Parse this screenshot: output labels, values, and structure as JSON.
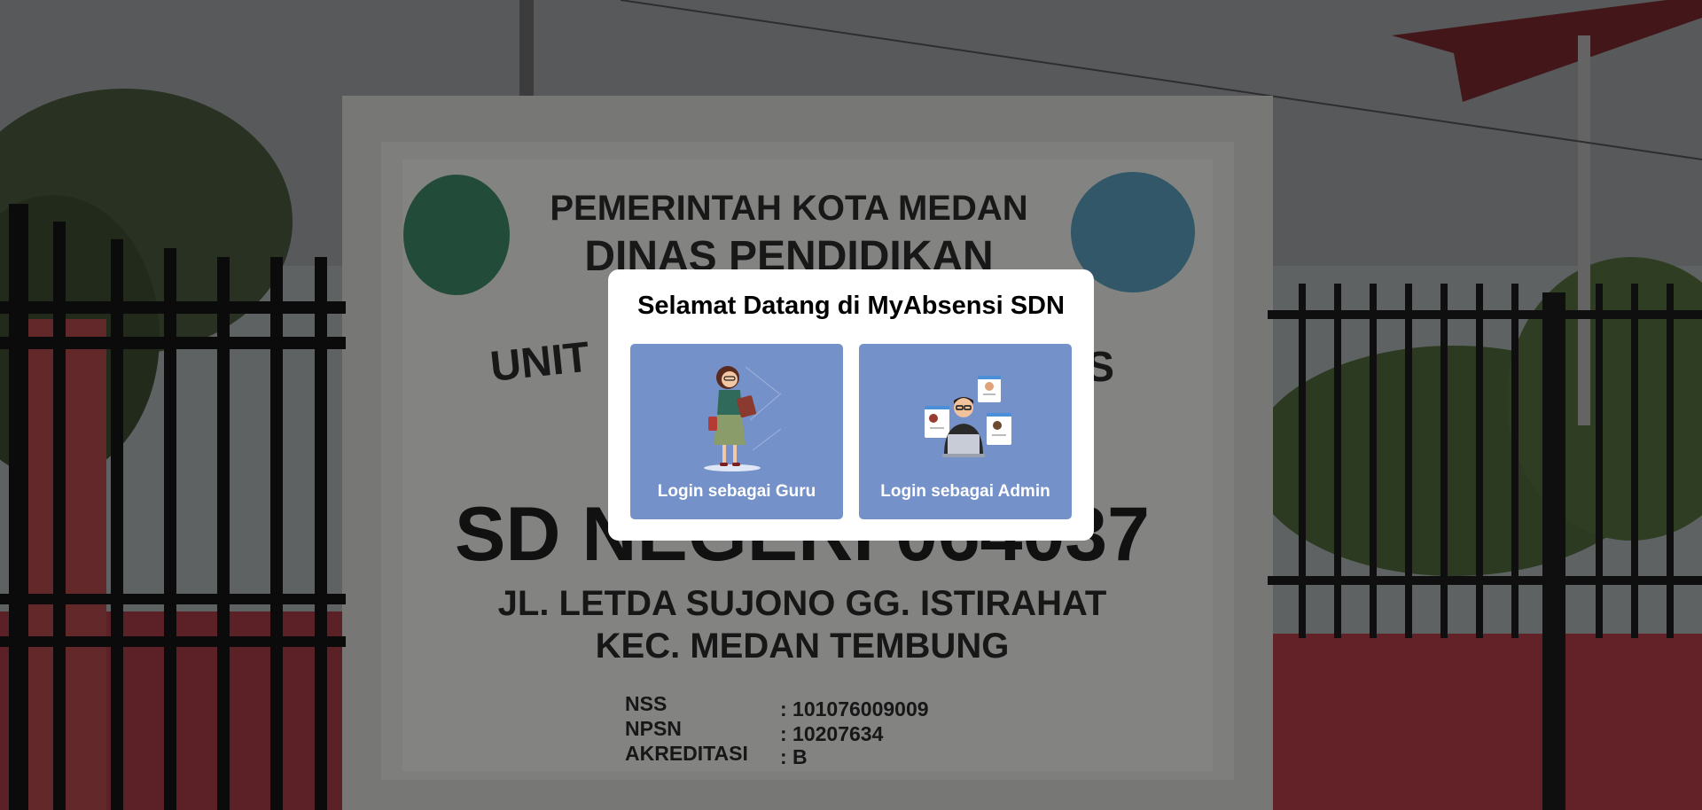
{
  "background": {
    "sign_lines": [
      "PEMERINTAH KOTA MEDAN",
      "DINAS PENDIDIKAN",
      "UNIT",
      "S",
      "SD NEGERI 064037",
      "JL. LETDA SUJONO GG. ISTIRAHAT",
      "KEC. MEDAN TEMBUNG"
    ],
    "sign_info": [
      {
        "key": "NSS",
        "value": ": 101076009009"
      },
      {
        "key": "NPSN",
        "value": ": 10207634"
      },
      {
        "key": "AKREDITASI",
        "value": ": B"
      }
    ]
  },
  "modal": {
    "title": "Selamat Datang di MyAbsensi SDN",
    "options": [
      {
        "label": "Login sebagai Guru",
        "icon": "teacher-illustration-icon"
      },
      {
        "label": "Login sebagai Admin",
        "icon": "admin-illustration-icon"
      }
    ]
  },
  "colors": {
    "card": "#7591c9",
    "overlay": "rgba(0,0,0,0.45)",
    "modal": "#ffffff"
  }
}
